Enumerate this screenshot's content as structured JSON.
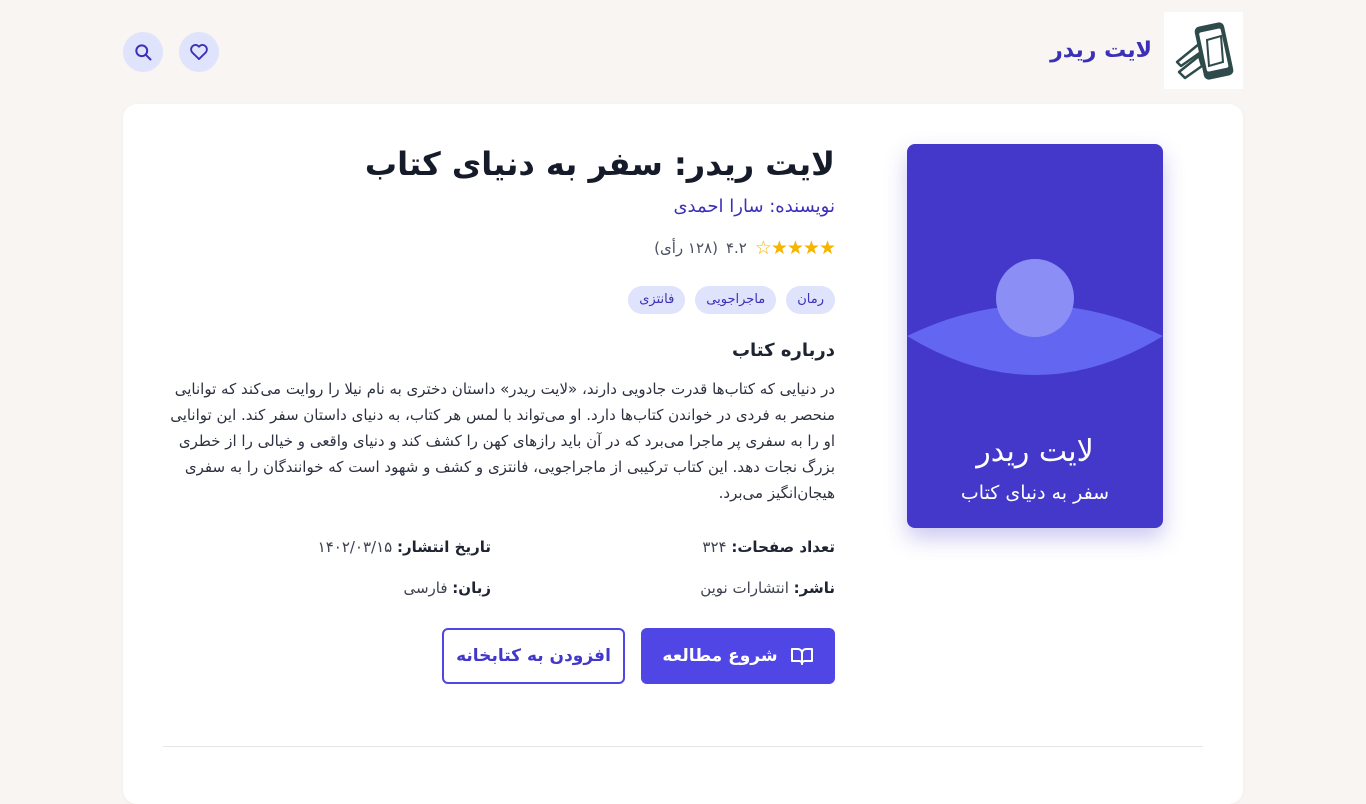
{
  "header": {
    "brand_title": "لایت ریدر",
    "logo_icon": "phone-book-logo",
    "search_icon": "search-icon",
    "favorite_icon": "heart-icon"
  },
  "book": {
    "cover": {
      "title": "لایت ریدر",
      "subtitle": "سفر به دنیای کتاب",
      "background_color": "#4338ca"
    },
    "title": "لایت ریدر: سفر به دنیای کتاب",
    "author": "نویسنده: سارا احمدی",
    "rating": {
      "stars_display": "★★★★☆",
      "score_text": "۴.۲",
      "votes_text": "(۱۲۸ رأی)"
    },
    "tags": [
      "رمان",
      "ماجراجویی",
      "فانتزی"
    ],
    "about_heading": "درباره کتاب",
    "description": "در دنیایی که کتاب‌ها قدرت جادویی دارند، «لایت ریدر» داستان دختری به نام نیلا را روایت می‌کند که توانایی منحصر به فردی در خواندن کتاب‌ها دارد. او می‌تواند با لمس هر کتاب، به دنیای داستان سفر کند. این توانایی او را به سفری پر ماجرا می‌برد که در آن باید رازهای کهن را کشف کند و دنیای واقعی و خیالی را از خطری بزرگ نجات دهد. این کتاب ترکیبی از ماجراجویی، فانتزی و کشف و شهود است که خوانندگان را به سفری هیجان‌انگیز می‌برد.",
    "meta": {
      "pages_label": "تعداد صفحات:",
      "pages_value": "۳۲۴",
      "date_label": "تاریخ انتشار:",
      "date_value": "۱۴۰۲/۰۳/۱۵",
      "publisher_label": "ناشر:",
      "publisher_value": "انتشارات نوین",
      "language_label": "زبان:",
      "language_value": "فارسی"
    },
    "actions": {
      "start_reading": "شروع مطالعه",
      "start_reading_icon": "book-open-icon",
      "add_to_library": "افزودن به کتابخانه"
    }
  },
  "colors": {
    "accent": "#4f46e5",
    "brand": "#3b30b8",
    "tag_bg": "#dfe3fb",
    "star": "#f5b400",
    "page_bg": "#f8f5f3"
  }
}
